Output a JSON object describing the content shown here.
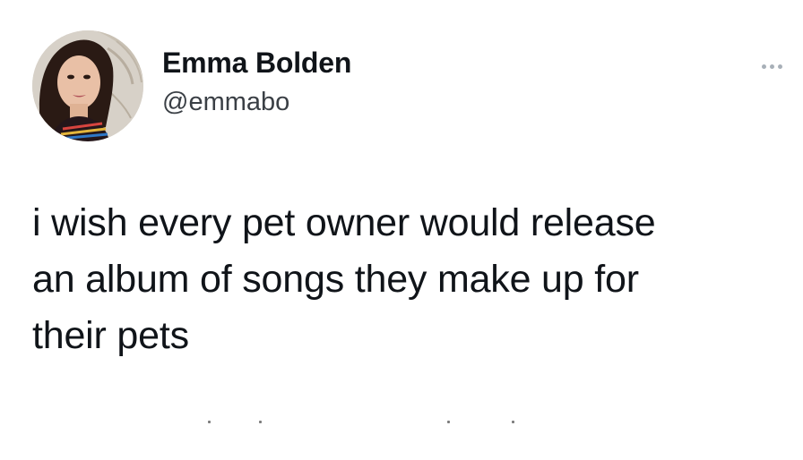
{
  "tweet": {
    "author": {
      "display_name": "Emma Bolden",
      "handle": "@emmabo",
      "avatar_icon": "profile-photo"
    },
    "more_icon": "more-horizontal-icon",
    "text": "i wish every pet owner would release\nan album of songs they make up for\ntheir pets"
  },
  "colors": {
    "text": "#101419",
    "handle": "#3a3f45",
    "more_dots": "#a8b0b8",
    "background": "#ffffff"
  }
}
